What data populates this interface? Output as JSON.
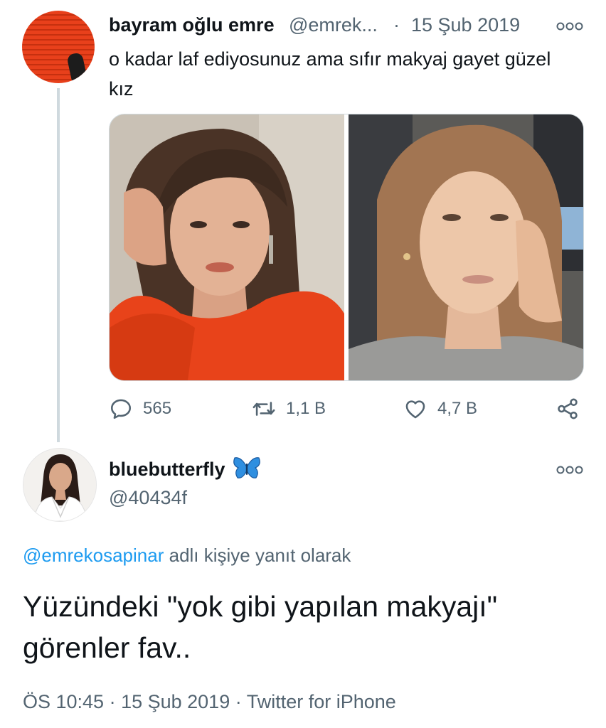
{
  "tweet1": {
    "display_name": "bayram oğlu emre",
    "handle": "@emrek...",
    "separator": "·",
    "date": "15 Şub 2019",
    "text": "o kadar laf ediyosunuz ama sıfır makyaj gayet güzel kız",
    "media_icons": [
      "photo-left",
      "photo-right"
    ],
    "actions": {
      "reply_icon": "reply-icon",
      "reply_count": "565",
      "retweet_icon": "retweet-icon",
      "retweet_count": "1,1 B",
      "like_icon": "heart-icon",
      "like_count": "4,7 B",
      "share_icon": "share-icon"
    }
  },
  "tweet2": {
    "display_name": "bluebutterfly",
    "name_emoji": "butterfly-icon",
    "handle": "@40434f",
    "reply_mention": "@emrekosapinar",
    "reply_rest": "adlı kişiye yanıt olarak",
    "text": "Yüzündeki \"yok gibi yapılan makyajı\" görenler fav..",
    "timestamp": "ÖS 10:45 · 15 Şub 2019 · Twitter for iPhone"
  },
  "colors": {
    "accent": "#1d9bf0",
    "secondary_text": "#536471",
    "primary_text": "#0f1419",
    "thread_line": "#cfd9de"
  }
}
